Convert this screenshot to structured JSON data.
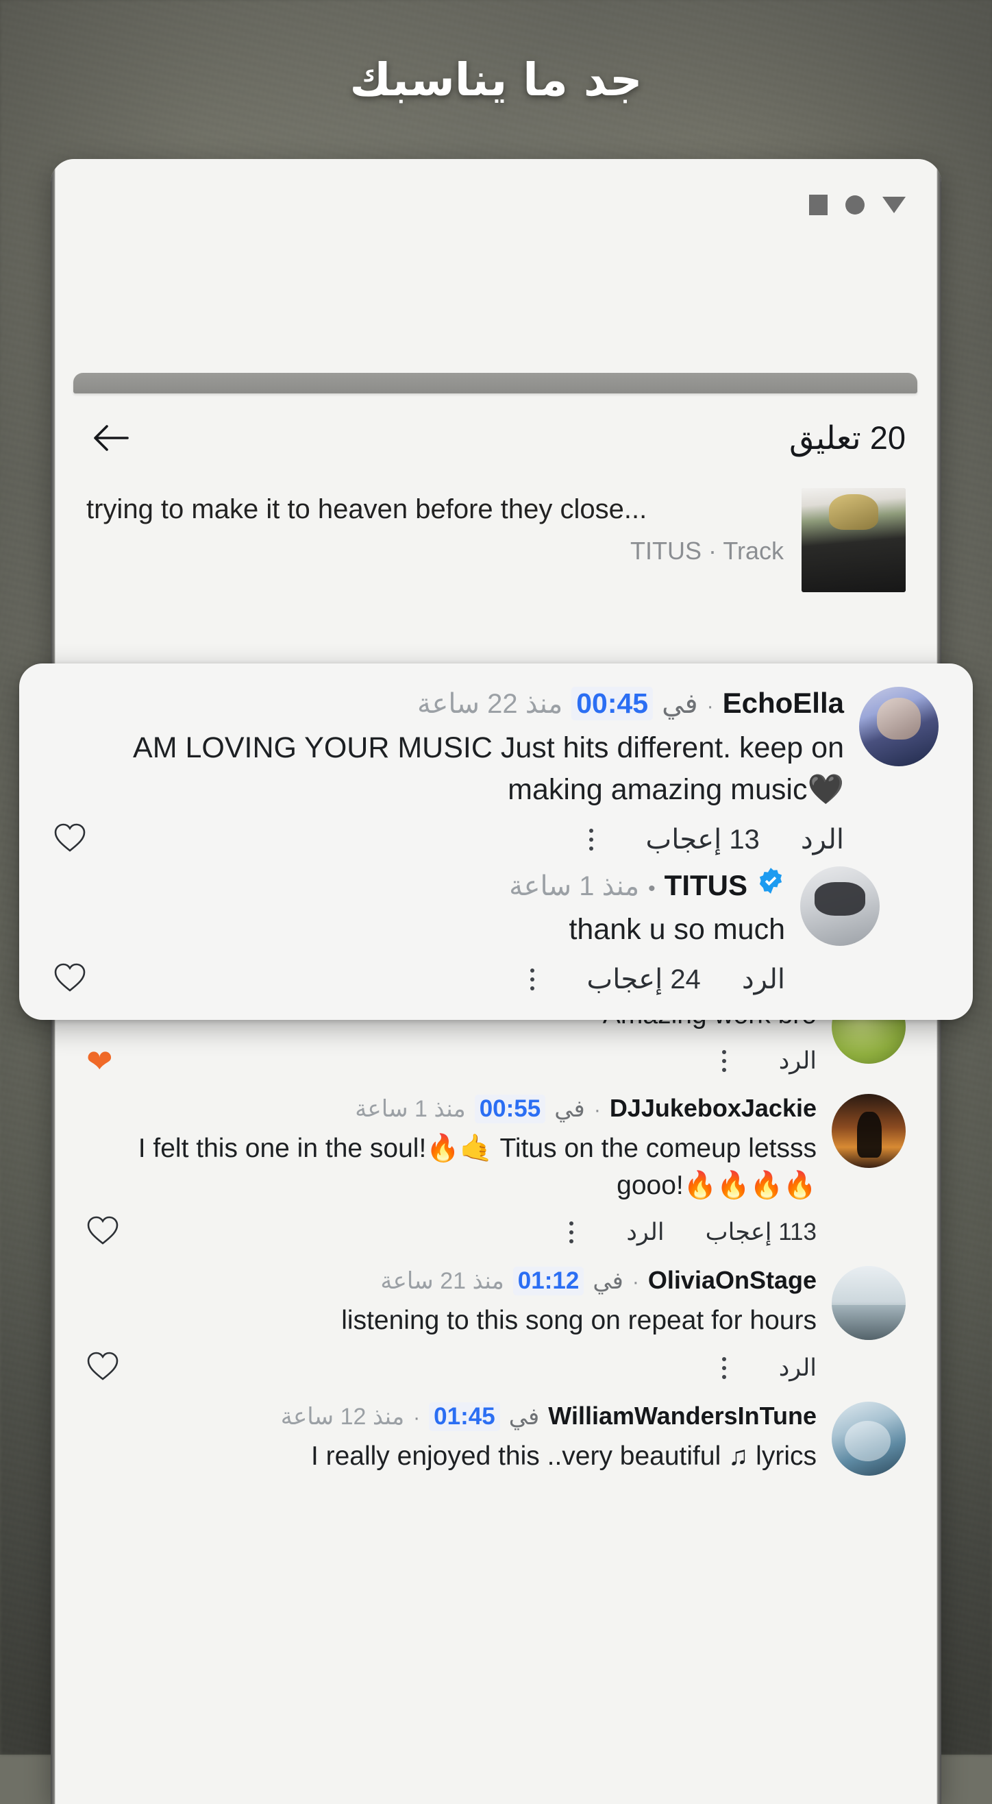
{
  "headline": "جد ما يناسبك",
  "phone": {
    "nav_glyphs": [
      "square",
      "circle",
      "triangle"
    ],
    "header": {
      "title": "20 تعليق",
      "back_label": "رجوع"
    },
    "track": {
      "title": "trying to make it to heaven before they close...",
      "subtitle": "TITUS · Track"
    }
  },
  "labels": {
    "reply": "الرد",
    "in": "في"
  },
  "popup": {
    "comment": {
      "username": "EchoElla",
      "sep": "·",
      "in_word": "في",
      "timestamp": "00:45",
      "ago": "منذ 22 ساعة",
      "text": "AM LOVING YOUR MUSIC Just hits different. keep on making amazing music🖤",
      "reply_label": "الرد",
      "likes_label": "13 إعجاب",
      "liked": false
    },
    "reply": {
      "username": "TITUS",
      "verified": true,
      "sep": "•",
      "ago": "منذ 1 ساعة",
      "text": "thank u so much",
      "reply_label": "الرد",
      "likes_label": "24 إعجاب",
      "liked": false
    }
  },
  "comments": [
    {
      "id": "partial-amazing-work",
      "username": "",
      "text": "Amazing work bro",
      "reply_label": "الرد",
      "likes_label": "",
      "liked": true,
      "avatar": "av-green"
    },
    {
      "id": "djjukeboxjackie",
      "username": "DJJukeboxJackie",
      "sep": "·",
      "in_word": "في",
      "timestamp": "00:55",
      "ago": "منذ 1 ساعة",
      "text": "I felt this one in the soul!🔥🤙 Titus on the comeup letsss gooo!🔥🔥🔥🔥",
      "reply_label": "الرد",
      "likes_label": "113 إعجاب",
      "liked": false,
      "avatar": "av-dj"
    },
    {
      "id": "oliviaonstage",
      "username": "OliviaOnStage",
      "sep": "·",
      "in_word": "في",
      "timestamp": "01:12",
      "ago": "منذ 21 ساعة",
      "text": "listening to this song on repeat for hours",
      "reply_label": "الرد",
      "likes_label": "",
      "liked": false,
      "avatar": "av-olivia"
    },
    {
      "id": "williamwandersintune",
      "username": "WilliamWandersInTune",
      "sep": "·",
      "in_word": "في",
      "timestamp": "01:45",
      "ago": "منذ 12 ساعة",
      "text": "I really enjoyed this ..very beautiful ♫ lyrics",
      "reply_label": "",
      "likes_label": "",
      "liked": false,
      "avatar": "av-william"
    }
  ],
  "colors": {
    "accent_blue": "#2b6ef3",
    "liked_heart": "#f06a28",
    "verified_blue": "#1d9bf0",
    "bg": "#6f7066",
    "card": "#f5f5f4"
  }
}
